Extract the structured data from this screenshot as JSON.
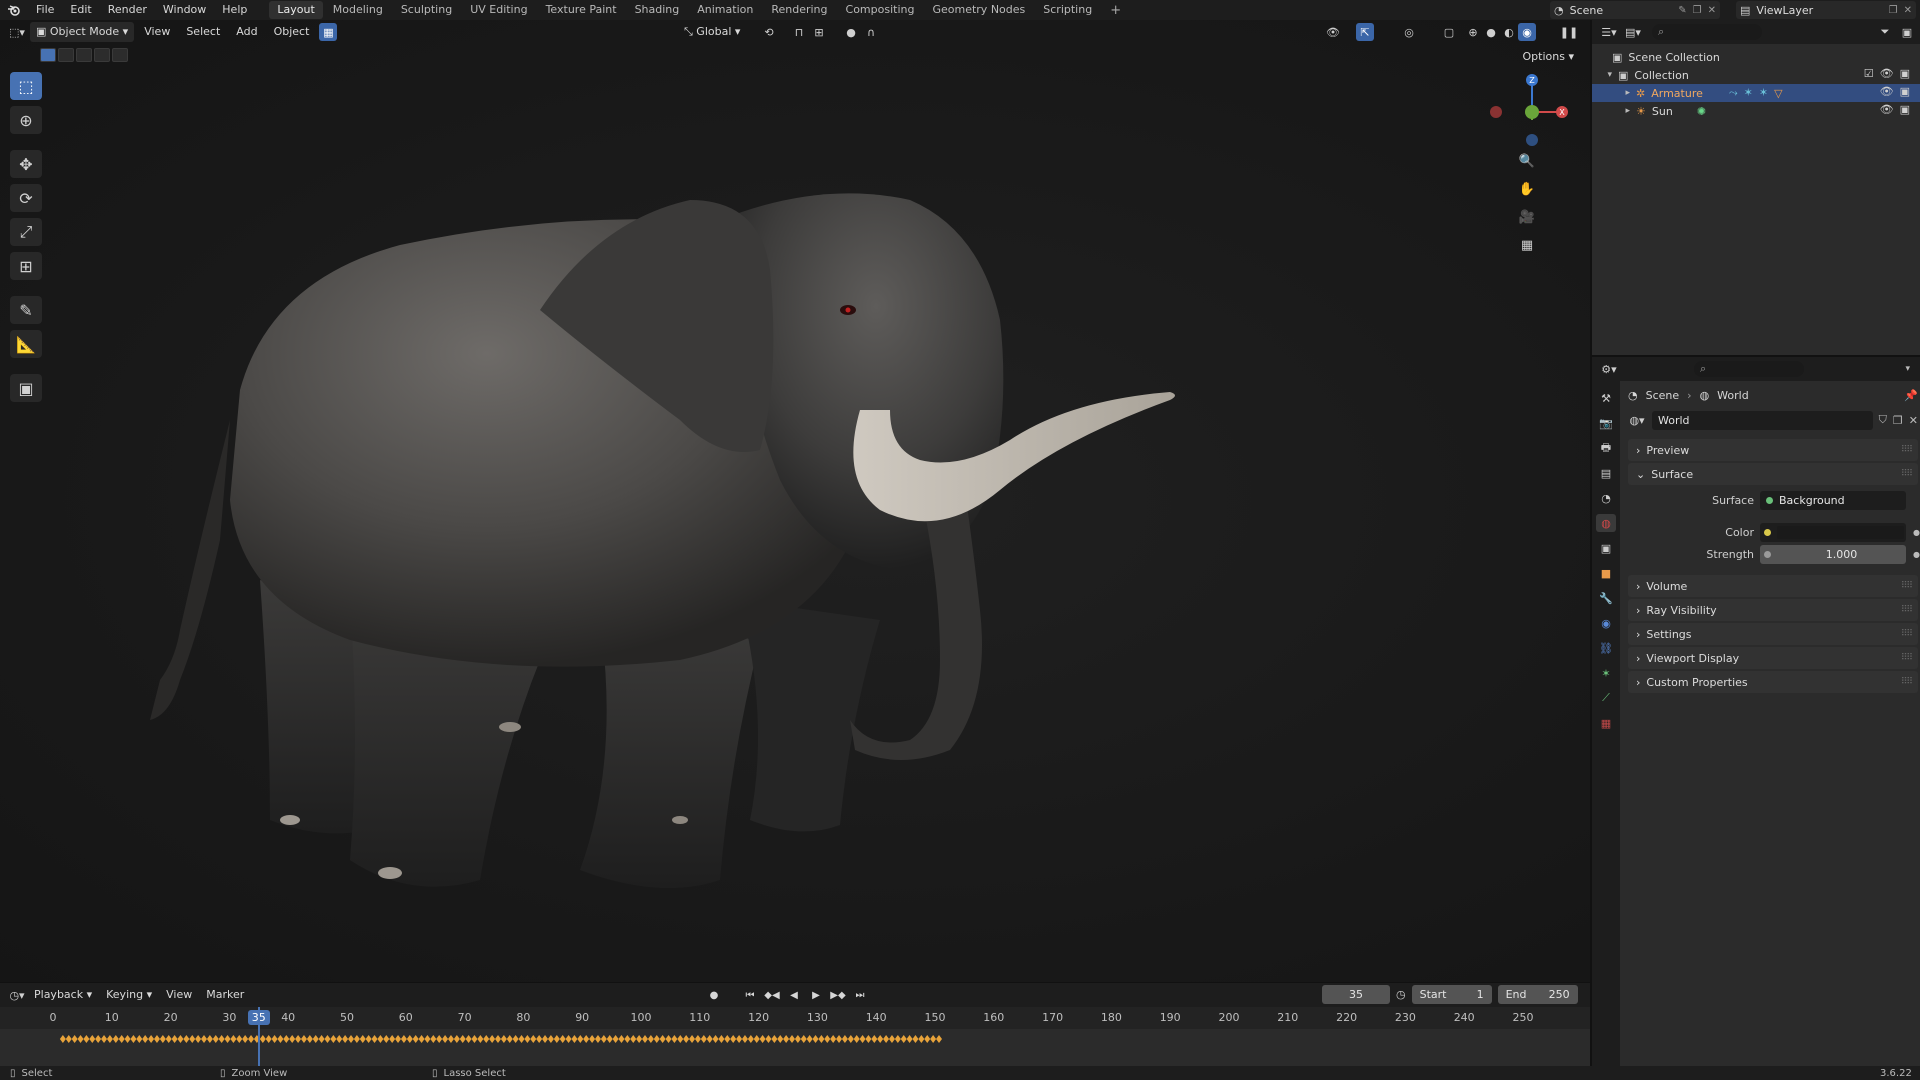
{
  "menubar": {
    "items": [
      "File",
      "Edit",
      "Render",
      "Window",
      "Help"
    ],
    "workspaces": [
      "Layout",
      "Modeling",
      "Sculpting",
      "UV Editing",
      "Texture Paint",
      "Shading",
      "Animation",
      "Rendering",
      "Compositing",
      "Geometry Nodes",
      "Scripting"
    ],
    "active_workspace": "Layout",
    "scene_name": "Scene",
    "view_layer": "ViewLayer"
  },
  "viewport": {
    "mode_label": "Object Mode",
    "menus": [
      "View",
      "Select",
      "Add",
      "Object"
    ],
    "transform_orientation": "Global",
    "options_label": "Options",
    "gizmo_axes": [
      "Z",
      "X",
      "Y"
    ],
    "tools": [
      "select-box-icon",
      "cursor-icon",
      "move-icon",
      "rotate-icon",
      "scale-icon",
      "transform-icon",
      "annotate-icon",
      "measure-icon",
      "add-cube-icon"
    ]
  },
  "timeline": {
    "menus": [
      "Playback",
      "Keying",
      "View",
      "Marker"
    ],
    "current_frame": "35",
    "start_label": "Start",
    "start_value": "1",
    "end_label": "End",
    "end_value": "250",
    "ticks": [
      "0",
      "10",
      "20",
      "30",
      "40",
      "50",
      "60",
      "70",
      "80",
      "90",
      "100",
      "110",
      "120",
      "130",
      "140",
      "150",
      "160",
      "170",
      "180",
      "190",
      "200",
      "210",
      "220",
      "230",
      "240",
      "250"
    ],
    "playhead_label": "35",
    "keyframe_range": [
      1,
      150
    ]
  },
  "statusbar": {
    "select": "Select",
    "zoom": "Zoom View",
    "lasso": "Lasso Select",
    "version": "3.6.22"
  },
  "outliner": {
    "root": "Scene Collection",
    "collection": "Collection",
    "items": [
      {
        "name": "Armature",
        "selected": true
      },
      {
        "name": "Sun",
        "selected": false
      }
    ]
  },
  "properties": {
    "breadcrumb_scene": "Scene",
    "breadcrumb_world": "World",
    "world_name": "World",
    "panels": {
      "preview": "Preview",
      "surface": "Surface",
      "volume": "Volume",
      "ray_visibility": "Ray Visibility",
      "settings": "Settings",
      "viewport_display": "Viewport Display",
      "custom_properties": "Custom Properties"
    },
    "surface_label": "Surface",
    "surface_value": "Background",
    "color_label": "Color",
    "strength_label": "Strength",
    "strength_value": "1.000"
  },
  "colors": {
    "accent_blue": "#4772b3",
    "selected_row": "#334d80",
    "keyframe": "#e8a33a"
  }
}
